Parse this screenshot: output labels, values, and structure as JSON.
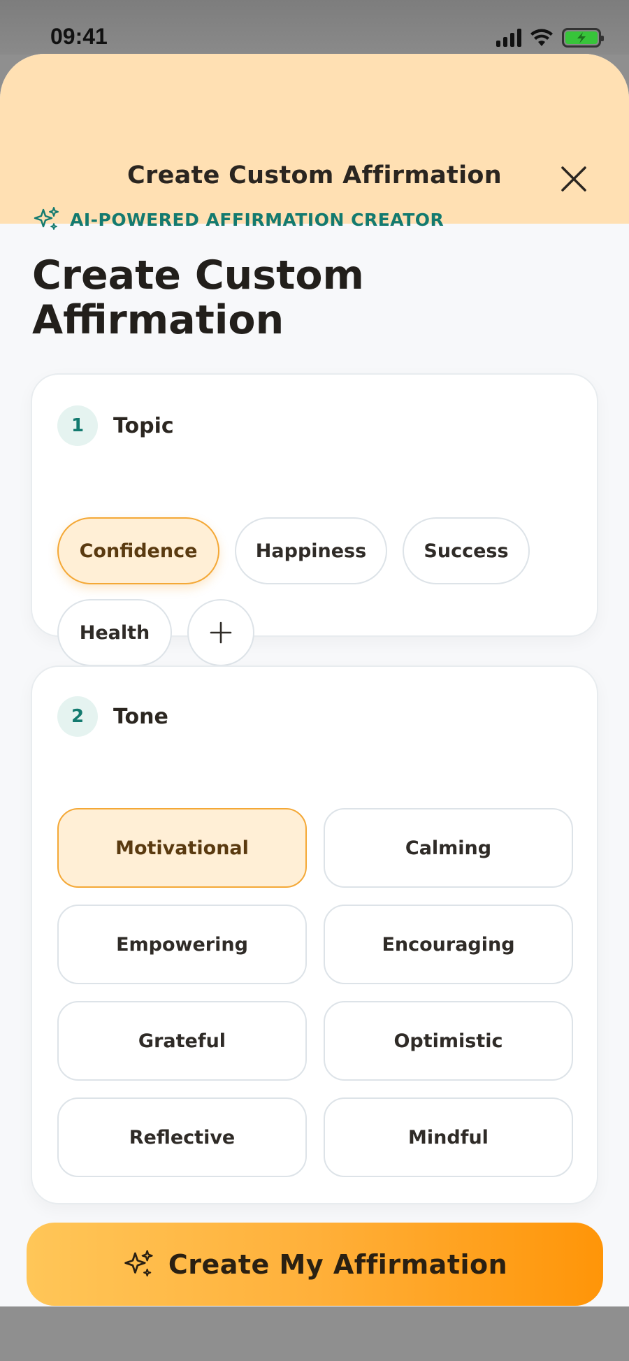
{
  "status_bar": {
    "time": "09:41",
    "battery_color": "#37c43a"
  },
  "header": {
    "title": "Create Custom Affirmation",
    "close_icon": "close-icon"
  },
  "intro": {
    "eyebrow": "AI-POWERED AFFIRMATION CREATOR",
    "eyebrow_icon": "sparkles-icon",
    "title": "Create Custom Affirmation"
  },
  "topic": {
    "number": "1",
    "label": "Topic",
    "options": [
      "Confidence",
      "Happiness",
      "Success",
      "Health"
    ],
    "selected": "Confidence",
    "add_icon": "plus-icon"
  },
  "tone": {
    "number": "2",
    "label": "Tone",
    "options": [
      "Motivational",
      "Calming",
      "Empowering",
      "Encouraging",
      "Grateful",
      "Optimistic",
      "Reflective",
      "Mindful"
    ],
    "selected": "Motivational"
  },
  "cta": {
    "label": "Create My Affirmation",
    "icon": "sparkles-icon"
  },
  "colors": {
    "accent_teal": "#137a6f",
    "accent_orange": "#f4a836",
    "header_bg": "#ffe0b3",
    "selected_bg": "#ffefd6"
  }
}
